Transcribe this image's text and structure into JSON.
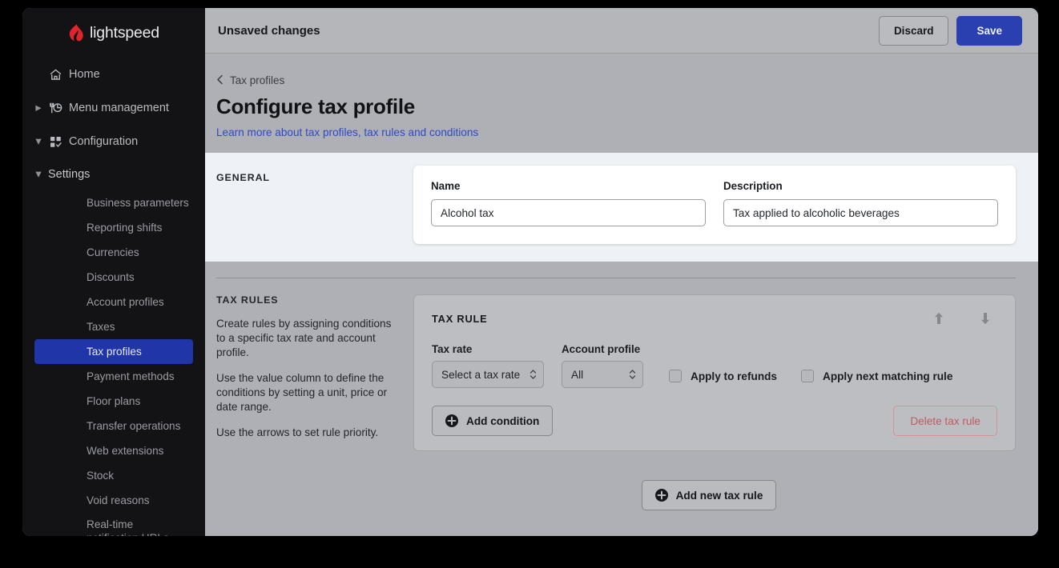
{
  "brand": {
    "name": "lightspeed",
    "logo_icon": "lightspeed-flame-logo",
    "accent": "#e0242b"
  },
  "sidebar": {
    "nav": [
      {
        "label": "Home",
        "icon": "home-icon",
        "caret": "",
        "name": "home"
      },
      {
        "label": "Menu management",
        "icon": "menu-management-icon",
        "caret": "▸",
        "name": "menu-management"
      },
      {
        "label": "Configuration",
        "icon": "configuration-icon",
        "caret": "▾",
        "name": "configuration"
      }
    ],
    "settings": {
      "label": "Settings",
      "caret": "▾"
    },
    "items": [
      {
        "label": "Business parameters",
        "active": false
      },
      {
        "label": "Reporting shifts",
        "active": false
      },
      {
        "label": "Currencies",
        "active": false
      },
      {
        "label": "Discounts",
        "active": false
      },
      {
        "label": "Account profiles",
        "active": false
      },
      {
        "label": "Taxes",
        "active": false
      },
      {
        "label": "Tax profiles",
        "active": true
      },
      {
        "label": "Payment methods",
        "active": false
      },
      {
        "label": "Floor plans",
        "active": false
      },
      {
        "label": "Transfer operations",
        "active": false
      },
      {
        "label": "Web extensions",
        "active": false
      },
      {
        "label": "Stock",
        "active": false
      },
      {
        "label": "Void reasons",
        "active": false
      },
      {
        "label": "Real-time notification URLs",
        "active": false
      }
    ],
    "active_color": "#1f35a8"
  },
  "topbar": {
    "status": "Unsaved changes",
    "discard_label": "Discard",
    "save_label": "Save",
    "save_color": "#2a3fb0"
  },
  "page": {
    "breadcrumb": "Tax profiles",
    "breadcrumb_icon": "chevron-left-icon",
    "title": "Configure tax profile",
    "learn_link": "Learn more about tax profiles, tax rules and conditions",
    "link_color": "#2f49c4"
  },
  "general": {
    "section_label": "GENERAL",
    "name_label": "Name",
    "name_value": "Alcohol tax",
    "description_label": "Description",
    "description_value": "Tax applied to alcoholic beverages"
  },
  "tax_rules": {
    "section_label": "TAX RULES",
    "paragraphs": [
      "Create rules by assigning conditions to a specific tax rate and account profile.",
      "Use the value column to define the conditions by setting a unit, price or date range.",
      "Use the arrows to set rule priority."
    ],
    "card": {
      "title": "TAX RULE",
      "move_up_icon": "arrow-up-icon",
      "move_down_icon": "arrow-down-icon",
      "tax_rate_label": "Tax rate",
      "tax_rate_value": "Select a tax rate",
      "account_profile_label": "Account profile",
      "account_profile_value": "All",
      "apply_refunds_label": "Apply to refunds",
      "apply_refunds_checked": false,
      "apply_next_label": "Apply next matching rule",
      "apply_next_checked": false,
      "add_condition_label": "Add condition",
      "delete_label": "Delete tax rule",
      "delete_color": "#c25a63"
    },
    "add_new_label": "Add new tax rule"
  }
}
